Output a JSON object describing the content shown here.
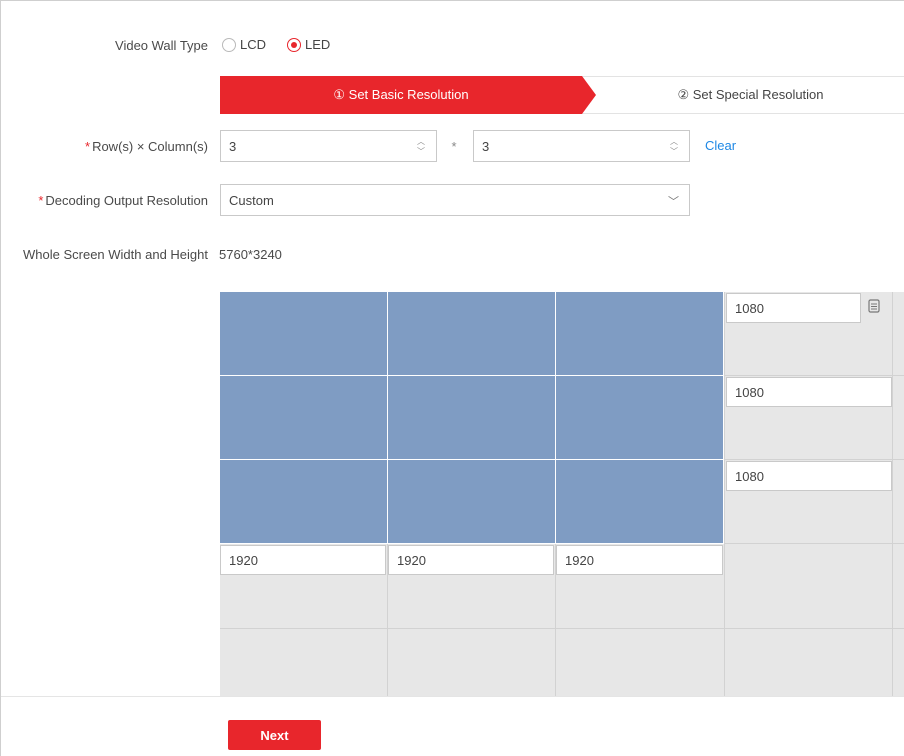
{
  "video_wall_type": {
    "label": "Video Wall Type",
    "options": [
      {
        "label": "LCD",
        "checked": false
      },
      {
        "label": "LED",
        "checked": true
      }
    ]
  },
  "steps": [
    {
      "label": "① Set Basic Resolution",
      "active": true
    },
    {
      "label": "② Set Special Resolution",
      "active": false
    }
  ],
  "rows_columns": {
    "required_mark": "*",
    "label": "Row(s) × Column(s)",
    "rows": "3",
    "separator": "*",
    "columns": "3",
    "clear_label": "Clear"
  },
  "decoding": {
    "required_mark": "*",
    "label": "Decoding Output Resolution",
    "value": "Custom"
  },
  "whole_screen": {
    "label": "Whole Screen Width and Height",
    "value": "5760*3240"
  },
  "grid": {
    "row_heights": [
      "1080",
      "1080",
      "1080"
    ],
    "column_widths": [
      "1920",
      "1920",
      "1920"
    ]
  },
  "footer": {
    "next_label": "Next"
  },
  "colors": {
    "accent": "#e8262c",
    "screen_fill": "#7f9cc3",
    "link": "#1e88e5",
    "grid_bg": "#e7e7e7"
  }
}
